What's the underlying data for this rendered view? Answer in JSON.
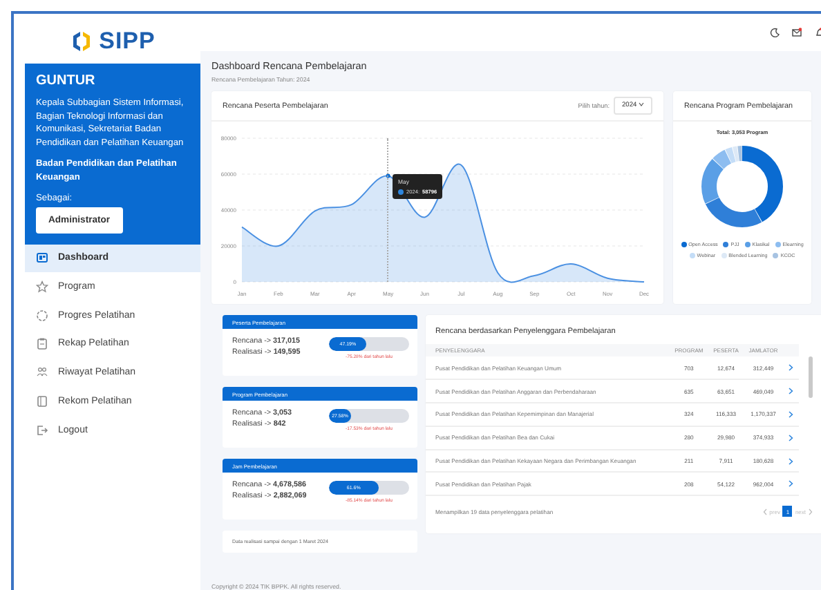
{
  "logo": {
    "text": "SIPP"
  },
  "profile": {
    "name": "GUNTUR",
    "position": "Kepala Subbagian Sistem Informasi, Bagian Teknologi Informasi dan Komunikasi, Sekretariat Badan Pendidikan dan Pelatihan Keuangan",
    "unit": "Badan Pendidikan dan Pelatihan Keuangan",
    "role_label": "Sebagai:",
    "role": "Administrator"
  },
  "nav": [
    {
      "label": "Dashboard",
      "selected": true
    },
    {
      "label": "Program",
      "selected": false
    },
    {
      "label": "Progres Pelatihan",
      "selected": false
    },
    {
      "label": "Rekap Pelatihan",
      "selected": false
    },
    {
      "label": "Riwayat Pelatihan",
      "selected": false
    },
    {
      "label": "Rekom Pelatihan",
      "selected": false
    },
    {
      "label": "Logout",
      "selected": false
    }
  ],
  "page": {
    "title": "Dashboard Rencana Pembelajaran",
    "subtitle": "Rencana Pembelajaran Tahun: 2024"
  },
  "participants_chart": {
    "title": "Rencana Peserta Pembelajaran",
    "year_label": "Pilih tahun:",
    "year": "2024",
    "tooltip": {
      "title": "May",
      "separator": ":",
      "value": "58796"
    },
    "chart_data": {
      "type": "area",
      "categories": [
        "Jan",
        "Feb",
        "Mar",
        "Apr",
        "May",
        "Jun",
        "Jul",
        "Aug",
        "Sep",
        "Oct",
        "Nov",
        "Dec"
      ],
      "series": [
        {
          "name": "2024",
          "color": "#4a90e2",
          "values": [
            30500,
            20000,
            39500,
            43000,
            59000,
            36000,
            65000,
            5000,
            3500,
            10000,
            2000,
            0
          ]
        }
      ],
      "ylim": [
        0,
        80000
      ],
      "yticks": [
        0,
        20000,
        40000,
        60000,
        80000
      ],
      "grid": true
    }
  },
  "program_chart": {
    "title": "Rencana Program Pembelajaran",
    "total": "Total: 3,053 Program",
    "legend": [
      {
        "label": "Open Access",
        "color": "#0a6bd1"
      },
      {
        "label": "PJJ",
        "color": "#2f7fd8"
      },
      {
        "label": "Klasikal",
        "color": "#5a9fe6"
      },
      {
        "label": "Elearning",
        "color": "#8dbdf0"
      },
      {
        "label": "Webinar",
        "color": "#c4ddf7"
      },
      {
        "label": "Blended Learning",
        "color": "#dde9f6"
      },
      {
        "label": "KCOC",
        "color": "#a7c3e2"
      }
    ]
  },
  "summaries": [
    {
      "title": "Peserta Pembelajaran",
      "plan": "Rencana -> **317,015**",
      "actual": "Realisasi -> **149,595**",
      "level": 0.4719,
      "percent": "47.19%",
      "change": "-75.28% dari tahun lalu"
    },
    {
      "title": "Program Pembelajaran",
      "plan": "Rencana -> **3,053**",
      "actual": "Realisasi -> **842**",
      "level": 0.2758,
      "percent": "27.58%",
      "change": "-17.53% dari tahun lalu"
    },
    {
      "title": "Jam Pembelajaran",
      "plan": "Rencana -> **4,678,586**",
      "actual": "Realisasi -> **2,882,069**",
      "level": 0.616,
      "percent": "61.6%",
      "change": "-85.14% dari tahun lalu"
    }
  ],
  "note": "Data realisasi sampai dengan 1 Maret 2024",
  "table": {
    "title": "Rencana berdasarkan Penyelenggara Pembelajaran",
    "columns": [
      "PENYELENGGARA",
      "PROGRAM",
      "PESERTA",
      "JAMLATOR"
    ],
    "rows": [
      [
        "Pusat Pendidikan dan Pelatihan Keuangan Umum",
        "703",
        "12,674",
        "312,449"
      ],
      [
        "Pusat Pendidikan dan Pelatihan Anggaran dan Perbendaharaan",
        "635",
        "63,651",
        "469,049"
      ],
      [
        "Pusat Pendidikan dan Pelatihan Kepemimpinan dan Manajerial",
        "324",
        "116,333",
        "1,170,337"
      ],
      [
        "Pusat Pendidikan dan Pelatihan Bea dan Cukai",
        "280",
        "29,980",
        "374,933"
      ],
      [
        "Pusat Pendidikan dan Pelatihan Kekayaan Negara dan Perimbangan Keuangan",
        "211",
        "7,911",
        "180,628"
      ],
      [
        "Pusat Pendidikan dan Pelatihan Pajak",
        "208",
        "54,122",
        "962,004"
      ]
    ],
    "footer": "Menampilkan 19 data penyelenggara pelatihan",
    "pages": [
      {
        "label": "1",
        "selected": true
      }
    ],
    "prev": "prev",
    "next": "next"
  },
  "copyright": "Copyright © 2024 TIK BPPK. All rights reserved."
}
